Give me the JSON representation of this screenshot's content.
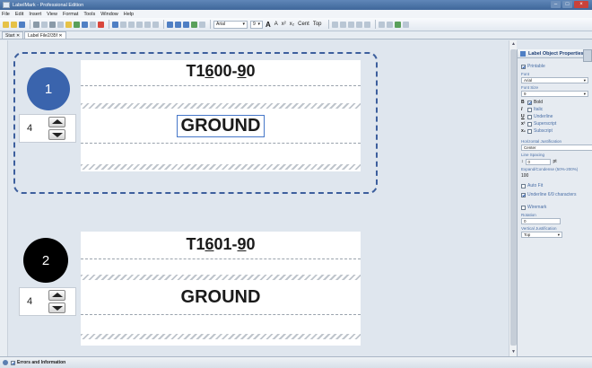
{
  "window": {
    "title": "LabelMark - Professional Edition"
  },
  "menu": [
    "File",
    "Edit",
    "Insert",
    "View",
    "Format",
    "Tools",
    "Window",
    "Help"
  ],
  "toolbar": {
    "font_name": "Arial",
    "font_size": "9",
    "halign": "Cent",
    "valign": "Top",
    "big_a": "A",
    "small_a": "A",
    "sup": "x²",
    "sub": "x₂"
  },
  "tabs": [
    "Start",
    "Label File2/35f"
  ],
  "records": [
    {
      "number": "1",
      "quantity": "4",
      "line1_pre": "T1",
      "line1_ul": "6",
      "line1_mid": "00-",
      "line1_ul2": "9",
      "line1_post": "0",
      "line2": "GROUND",
      "circle_color": "#3a64ad"
    },
    {
      "number": "2",
      "quantity": "4",
      "line1_pre": "T1",
      "line1_ul": "6",
      "line1_mid": "01-",
      "line1_ul2": "9",
      "line1_post": "0",
      "line2": "GROUND",
      "circle_color": "#000000"
    }
  ],
  "panel": {
    "title": "Label Object Properties",
    "printable": "Printable",
    "font_label": "Font",
    "font_value": "Arial",
    "font_size_label": "Font Size",
    "font_size_value": "9",
    "bold": "Bold",
    "italic": "Italic",
    "underline": "Underline",
    "superscript": "Superscript",
    "subscript": "Subscript",
    "hjust_label": "Horizontal Justification",
    "hjust_value": "Center",
    "line_spacing_label": "Line Spacing",
    "line_spacing_value": "0",
    "line_spacing_unit": "pt",
    "expand_label": "Expand/Condense (50%-200%)",
    "expand_value": "100",
    "autofit": "Auto Fit",
    "underline69": "Underline 6/9 characters",
    "wirewrap": "Wiremark",
    "rotation_label": "Rotation",
    "rotation_value": "0",
    "vjust_label": "Vertical Justification",
    "vjust_value": "Top"
  },
  "bottom": {
    "label": "Errors and Information"
  }
}
